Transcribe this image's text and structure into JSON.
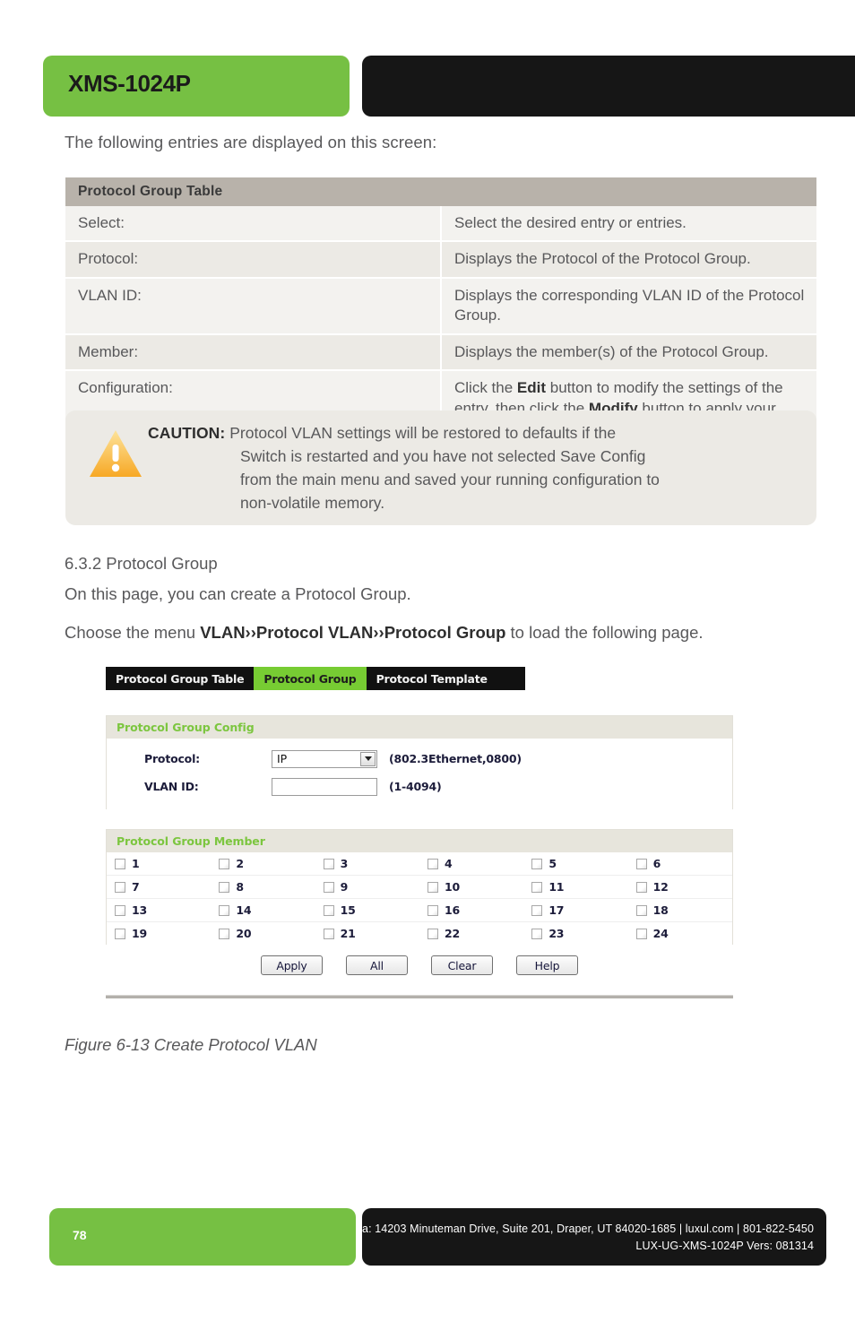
{
  "header": {
    "product_title": "XMS-1024P"
  },
  "intro": "The following entries are displayed on this screen:",
  "deftable": {
    "title": "Protocol Group Table",
    "rows": [
      {
        "label": "Select:",
        "desc": "Select the desired entry or entries."
      },
      {
        "label": "Protocol:",
        "desc": "Displays the Protocol of the Protocol Group."
      },
      {
        "label": "VLAN ID:",
        "desc": "Displays the corresponding VLAN ID of the Protocol Group."
      },
      {
        "label": "Member:",
        "desc": "Displays the member(s) of the Protocol Group."
      }
    ],
    "config_row": {
      "label": "Configuration:",
      "part1": "Click the ",
      "bold1": "Edit",
      "part2": " button to modify the settings of the entry, then click the ",
      "bold2": "Modify",
      "part3": " button to apply your changes."
    }
  },
  "caution": {
    "icon": "warning-triangle-icon",
    "label": "CAUTION:",
    "line1": "Protocol VLAN settings will be restored to defaults if the",
    "line2": "Switch is restarted and you have not selected Save Config",
    "line3": "from the main menu and saved your running configuration to",
    "line4": "non-volatile memory."
  },
  "section": {
    "heading": "6.3.2 Protocol Group",
    "paragraph1": "On this page, you can create a Protocol Group.",
    "p2_prefix": "Choose the menu ",
    "p2_bold": "VLAN››Protocol VLAN››Protocol Group",
    "p2_suffix": " to load the following page."
  },
  "screenshot": {
    "tabs": [
      {
        "label": "Protocol Group Table",
        "active": false
      },
      {
        "label": "Protocol Group",
        "active": true
      },
      {
        "label": "Protocol Template",
        "active": false
      }
    ],
    "config_panel": {
      "title": "Protocol Group Config",
      "protocol_label": "Protocol:",
      "protocol_value": "IP",
      "protocol_hint": "(802.3Ethernet,0800)",
      "vlan_label": "VLAN ID:",
      "vlan_value": "",
      "vlan_hint": "(1-4094)"
    },
    "member_panel": {
      "title": "Protocol Group Member",
      "ports": [
        [
          "1",
          "2",
          "3",
          "4",
          "5",
          "6"
        ],
        [
          "7",
          "8",
          "9",
          "10",
          "11",
          "12"
        ],
        [
          "13",
          "14",
          "15",
          "16",
          "17",
          "18"
        ],
        [
          "19",
          "20",
          "21",
          "22",
          "23",
          "24"
        ]
      ]
    },
    "buttons": [
      {
        "label": "Apply"
      },
      {
        "label": "All"
      },
      {
        "label": "Clear"
      },
      {
        "label": "Help"
      }
    ]
  },
  "figure_caption": "Figure 6-13 Create Protocol VLAN",
  "footer": {
    "page_number": "78",
    "line1": "a: 14203 Minuteman Drive, Suite 201, Draper, UT 84020-1685 | luxul.com | 801-822-5450",
    "line2": "LUX-UG-XMS-1024P  Vers: 081314"
  },
  "colors": {
    "brand_green": "#76c043",
    "tab_green": "#77cc33",
    "dark": "#161616",
    "table_header": "#b8b2aa"
  }
}
